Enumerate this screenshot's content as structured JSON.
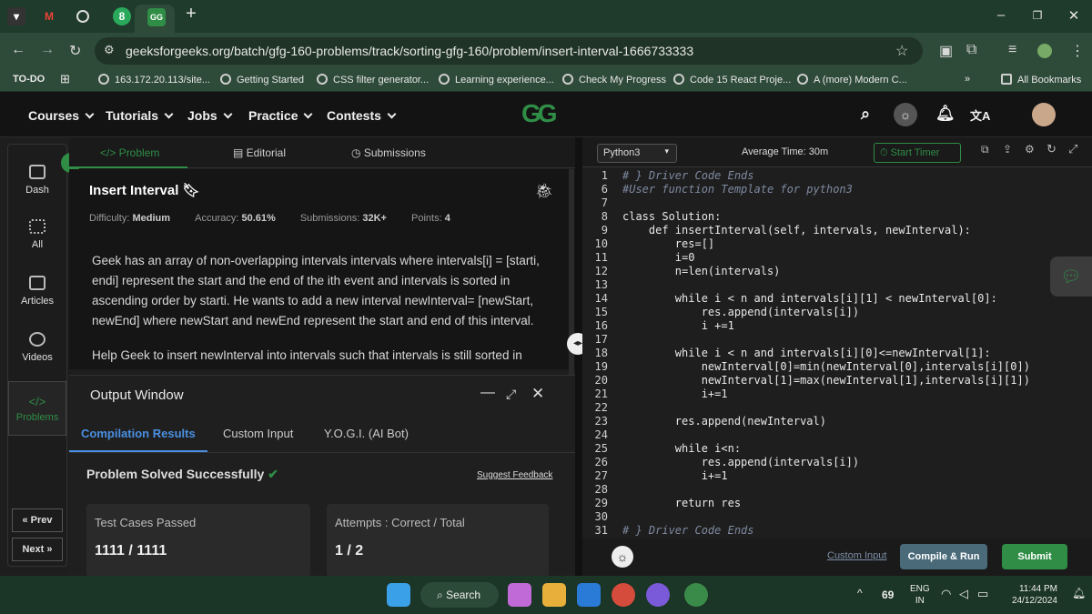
{
  "browser": {
    "url": "geeksforgeeks.org/batch/gfg-160-problems/track/sorting-gfg-160/problem/insert-interval-1666733333",
    "tab_badge": "8",
    "bookmarks": [
      "TO-DO",
      "163.172.20.113/site...",
      "Getting Started",
      "CSS filter generator...",
      "Learning experience...",
      "Check My Progress",
      "Code 15 React Proje...",
      "A (more) Modern C..."
    ],
    "all_bookmarks": "All Bookmarks"
  },
  "nav": {
    "items": [
      "Courses",
      "Tutorials",
      "Jobs",
      "Practice",
      "Contests"
    ],
    "logo": "GG"
  },
  "sidebar": {
    "items": [
      "Dash",
      "All",
      "Articles",
      "Videos",
      "Problems"
    ],
    "prev": "« Prev",
    "next": "Next »"
  },
  "problem_tabs": [
    "</> Problem",
    "Editorial",
    "Submissions"
  ],
  "problem": {
    "title": "Insert Interval",
    "difficulty_label": "Difficulty:",
    "difficulty": "Medium",
    "accuracy_label": "Accuracy:",
    "accuracy": "50.61%",
    "submissions_label": "Submissions:",
    "submissions": "32K+",
    "points_label": "Points:",
    "points": "4",
    "para1": "Geek has an array of non-overlapping intervals intervals where intervals[i] = [starti, endi] represent the start and the end of the ith event and intervals is sorted in ascending order by starti. He wants to add a new interval newInterval= [newStart, newEnd] where newStart and newEnd represent the start and end of this interval.",
    "para2": "Help Geek to insert newInterval into intervals such that intervals is still sorted in"
  },
  "output": {
    "title": "Output Window",
    "tabs": [
      "Compilation Results",
      "Custom Input",
      "Y.O.G.I. (AI Bot)"
    ],
    "status": "Problem Solved Successfully",
    "feedback": "Suggest Feedback",
    "card1_label": "Test Cases Passed",
    "card1_value": "1111 / 1111",
    "card2_label": "Attempts : Correct / Total",
    "card2_value": "1 / 2"
  },
  "editor": {
    "language": "Python3",
    "avg_time": "Average Time: 30m",
    "start_timer": "Start Timer",
    "lines": [
      {
        "n": "1",
        "t": "# } Driver Code Ends"
      },
      {
        "n": "6",
        "t": "#User function Template for python3"
      },
      {
        "n": "7",
        "t": ""
      },
      {
        "n": "8",
        "t": "class Solution:"
      },
      {
        "n": "9",
        "t": "    def insertInterval(self, intervals, newInterval):"
      },
      {
        "n": "10",
        "t": "        res=[]"
      },
      {
        "n": "11",
        "t": "        i=0"
      },
      {
        "n": "12",
        "t": "        n=len(intervals)"
      },
      {
        "n": "13",
        "t": ""
      },
      {
        "n": "14",
        "t": "        while i < n and intervals[i][1] < newInterval[0]:"
      },
      {
        "n": "15",
        "t": "            res.append(intervals[i])"
      },
      {
        "n": "16",
        "t": "            i +=1"
      },
      {
        "n": "17",
        "t": ""
      },
      {
        "n": "18",
        "t": "        while i < n and intervals[i][0]<=newInterval[1]:"
      },
      {
        "n": "19",
        "t": "            newInterval[0]=min(newInterval[0],intervals[i][0])"
      },
      {
        "n": "20",
        "t": "            newInterval[1]=max(newInterval[1],intervals[i][1])"
      },
      {
        "n": "21",
        "t": "            i+=1"
      },
      {
        "n": "22",
        "t": ""
      },
      {
        "n": "23",
        "t": "        res.append(newInterval)"
      },
      {
        "n": "24",
        "t": ""
      },
      {
        "n": "25",
        "t": "        while i<n:"
      },
      {
        "n": "26",
        "t": "            res.append(intervals[i])"
      },
      {
        "n": "27",
        "t": "            i+=1"
      },
      {
        "n": "28",
        "t": ""
      },
      {
        "n": "29",
        "t": "        return res"
      },
      {
        "n": "30",
        "t": ""
      },
      {
        "n": "31",
        "t": "# } Driver Code Ends"
      }
    ],
    "custom_input": "Custom Input",
    "compile_run": "Compile & Run",
    "submit": "Submit"
  },
  "taskbar": {
    "search": "Search",
    "notif_count": "69",
    "lang_line1": "ENG",
    "lang_line2": "IN",
    "time": "11:44 PM",
    "date": "24/12/2024"
  }
}
